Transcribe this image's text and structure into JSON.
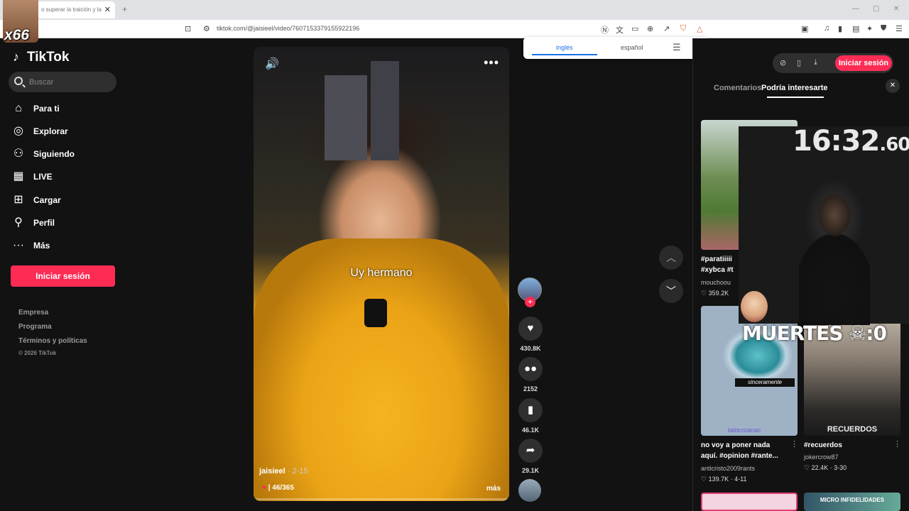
{
  "browser": {
    "tab_title": "o superar la traición y la",
    "tab_close": "✕",
    "new_tab": "+",
    "url": "tiktok.com/@jaisieel/video/7607153379155922196"
  },
  "overlay": {
    "streamer_tag": "x66"
  },
  "sidebar": {
    "logo": "TikTok",
    "search_placeholder": "Buscar",
    "items": [
      {
        "label": "Para ti"
      },
      {
        "label": "Explorar"
      },
      {
        "label": "Siguiendo"
      },
      {
        "label": "LIVE"
      },
      {
        "label": "Cargar"
      },
      {
        "label": "Perfil"
      },
      {
        "label": "Más"
      }
    ],
    "login": "Iniciar sesión",
    "footer": [
      "Empresa",
      "Programa",
      "Términos y políticas"
    ],
    "copyright": "© 2026 TikTok"
  },
  "video": {
    "caption": "Uy hermano",
    "author": "jaisieel",
    "date": " · 2-15",
    "description": "| 46/365",
    "more": "más",
    "progress": 0.0
  },
  "actions": {
    "likes": "430.8K",
    "comments": "2152",
    "saves": "46.1K",
    "shares": "29.1K"
  },
  "translate": {
    "lang_from": "inglés",
    "lang_to": "español"
  },
  "right_panel": {
    "login": "Iniciar sesión",
    "tabs": [
      "Comentarios",
      "Podría interesarte"
    ],
    "cards": [
      {
        "title1": "#paratiiiii",
        "title2": "#xybca #t",
        "author": "mouchoou",
        "meta": "359.2K"
      },
      {
        "title1": "no voy a poner nada",
        "title2": "aquí. #opinion #rante...",
        "author": "anticristo2009rants",
        "meta": "139.7K · 4-11",
        "thumb_text": "sinceramente",
        "thumb_text2": "talocroanac"
      },
      {
        "title1": "#recuerdos",
        "title2": "",
        "author": "jokercrow87",
        "meta": "22.4K · 3-30",
        "thumb_text": "RECUERDOS"
      },
      {
        "thumb_text": "MICRO INFIDELIDADES"
      }
    ]
  },
  "stream_overlay": {
    "timer": "16:32",
    "timer_ms": ".60",
    "deaths": "MUERTES ☠:0"
  },
  "colors": {
    "brand": "#fe2c55",
    "bg": "#121212"
  }
}
